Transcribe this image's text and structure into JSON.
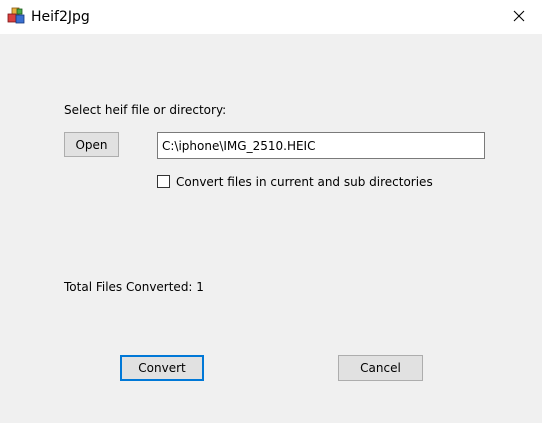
{
  "window": {
    "title": "Heif2Jpg",
    "app_icon": "app-cubes-icon",
    "close_icon": "close-icon"
  },
  "main": {
    "select_label": "Select heif file or directory:",
    "open_button": "Open",
    "path_value": "C:\\iphone\\IMG_2510.HEIC",
    "subdir_checkbox_label": "Convert files in current and sub directories",
    "subdir_checked": false,
    "total_label": "Total Files Converted: 1"
  },
  "actions": {
    "convert_button": "Convert",
    "cancel_button": "Cancel"
  },
  "colors": {
    "titlebar": "#ffffff",
    "client_background": "#f0f0f0",
    "button_face": "#e1e1e1",
    "default_button_border": "#0078d7"
  }
}
